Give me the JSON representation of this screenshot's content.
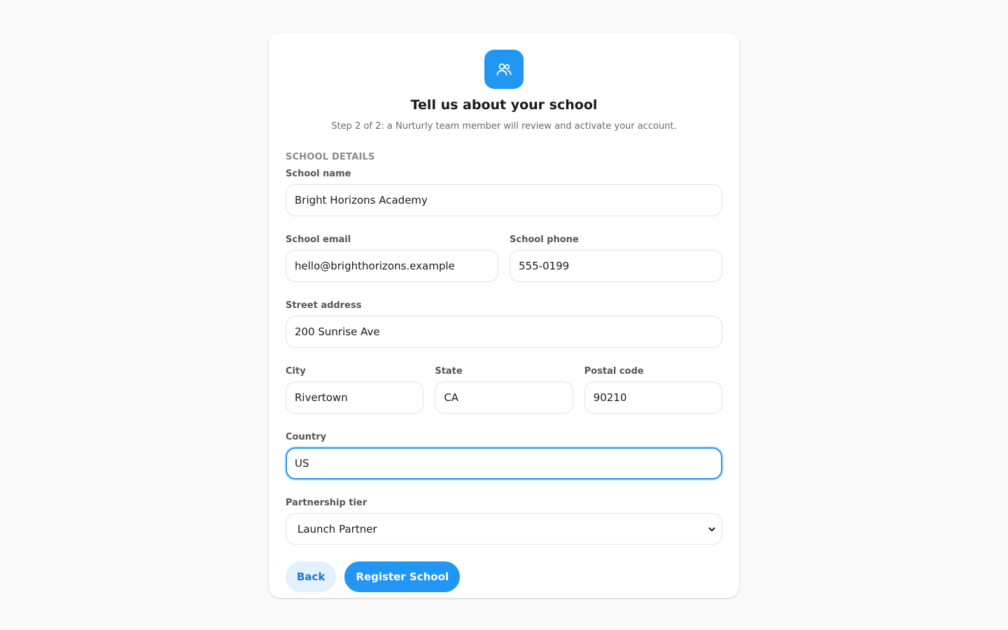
{
  "header": {
    "icon": "users-icon",
    "title": "Tell us about your school",
    "subtitle": "Step 2 of 2: a Nurturly team member will review and activate your account."
  },
  "section_title": "SCHOOL DETAILS",
  "fields": {
    "school_name": {
      "label": "School name",
      "value": "Bright Horizons Academy"
    },
    "school_email": {
      "label": "School email",
      "value": "hello@brighthorizons.example"
    },
    "school_phone": {
      "label": "School phone",
      "value": "555-0199"
    },
    "street_address": {
      "label": "Street address",
      "value": "200 Sunrise Ave"
    },
    "city": {
      "label": "City",
      "value": "Rivertown"
    },
    "state": {
      "label": "State",
      "value": "CA"
    },
    "postal_code": {
      "label": "Postal code",
      "value": "90210"
    },
    "country": {
      "label": "Country",
      "value": "US"
    },
    "partnership_tier": {
      "label": "Partnership tier",
      "value": "Launch Partner"
    }
  },
  "buttons": {
    "back": "Back",
    "register": "Register School"
  },
  "colors": {
    "accent": "#2196f3",
    "background": "#f9f9f9",
    "secondary_button": "#e3f1fd"
  }
}
